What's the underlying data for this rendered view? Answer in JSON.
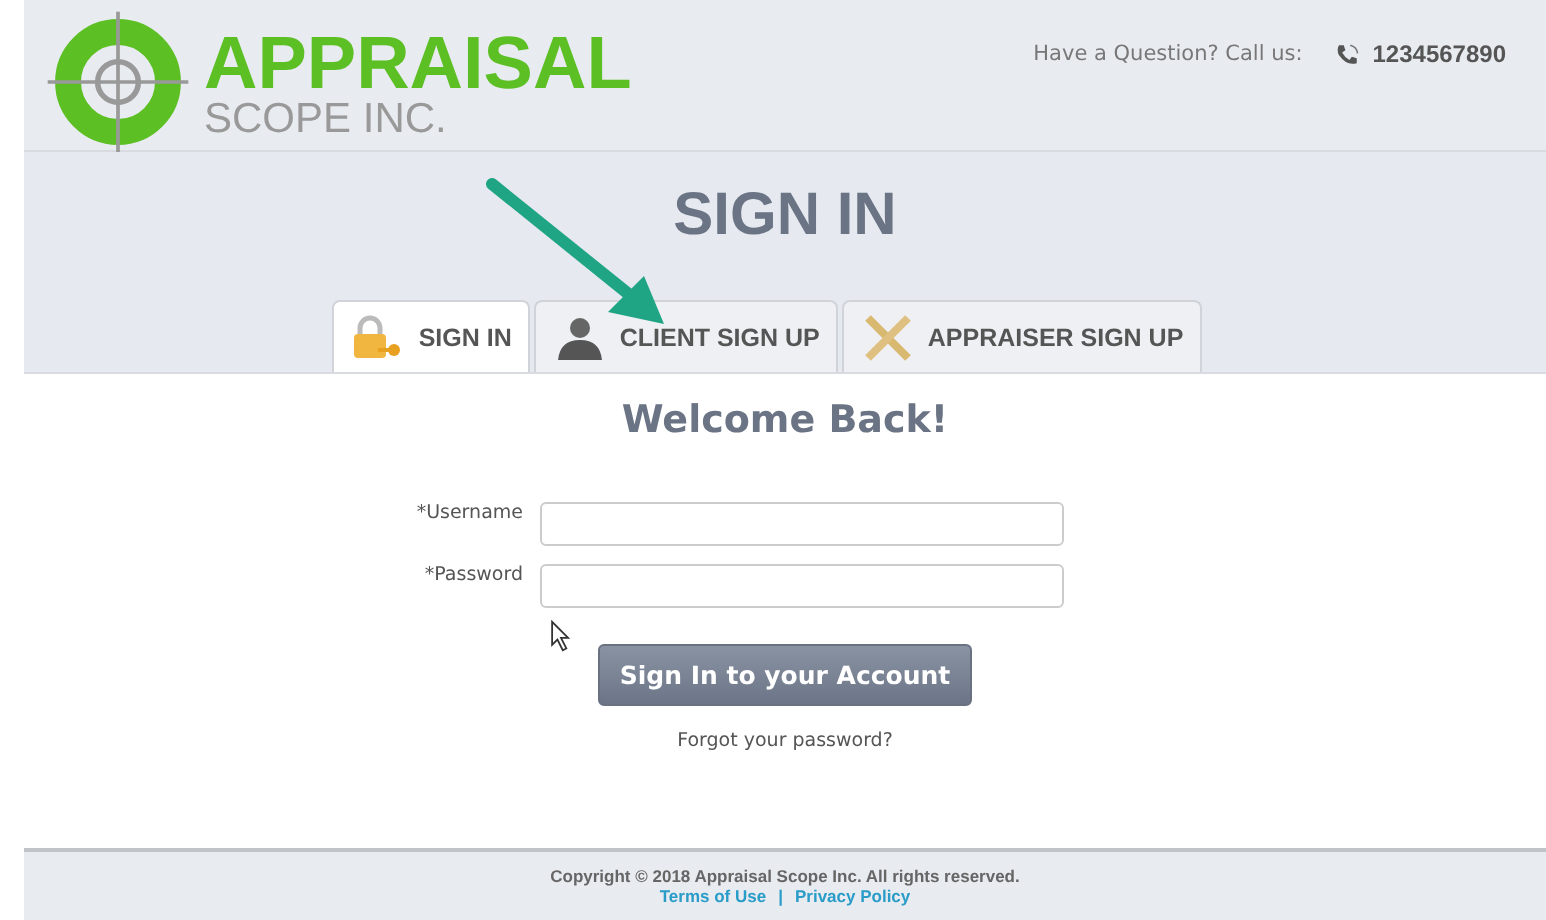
{
  "header": {
    "logo": {
      "name": "APPRAISAL",
      "subtitle": "SCOPE INC."
    },
    "contact_label": "Have a Question? Call us:",
    "phone": "1234567890"
  },
  "title": "SIGN IN",
  "tabs": [
    {
      "label": "SIGN IN",
      "kind": "lock",
      "selected": true
    },
    {
      "label": "CLIENT SIGN UP",
      "kind": "person",
      "selected": false
    },
    {
      "label": "APPRAISER SIGN UP",
      "kind": "pencil",
      "selected": false
    }
  ],
  "heading": "Welcome Back!",
  "fields": [
    {
      "label": "*Username"
    },
    {
      "label": "*Password"
    }
  ],
  "submit": "Sign In to your Account",
  "forgot_link": "Forgot your password?",
  "footer": {
    "copyright": "Copyright © 2018 Appraisal Scope Inc. All rights reserved.",
    "links": [
      "Terms of Use",
      "Privacy Policy"
    ],
    "separator": "|"
  }
}
